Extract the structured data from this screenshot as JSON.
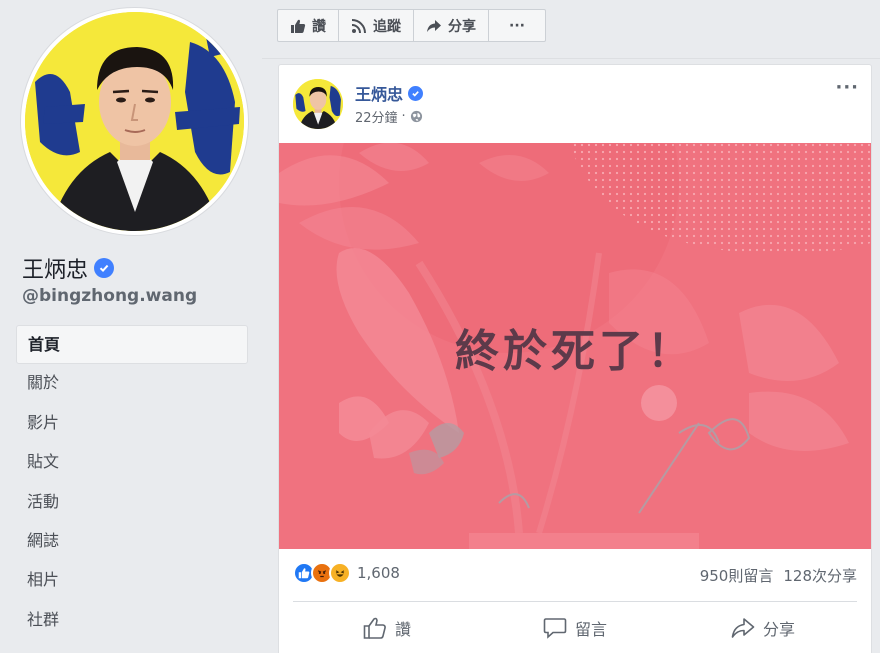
{
  "page": {
    "name": "王炳忠",
    "handle": "@bingzhong.wang"
  },
  "nav": {
    "items": [
      {
        "label": "首頁",
        "active": true
      },
      {
        "label": "關於"
      },
      {
        "label": "影片"
      },
      {
        "label": "貼文"
      },
      {
        "label": "活動"
      },
      {
        "label": "網誌"
      },
      {
        "label": "相片"
      },
      {
        "label": "社群"
      }
    ]
  },
  "action_bar": {
    "like_label": "讚",
    "follow_label": "追蹤",
    "share_label": "分享",
    "more_label": "···"
  },
  "post": {
    "author": "王炳忠",
    "time": "22分鐘",
    "more_label": "···",
    "image_text": "終於死了！",
    "image_bg": "#f0727f",
    "reaction_count": "1,608",
    "comments": "950則留言",
    "shares": "128次分享",
    "actions": {
      "like": "讚",
      "comment": "留言",
      "share": "分享"
    }
  },
  "colors": {
    "link_blue": "#365899",
    "verified_blue": "#4080ff",
    "like_blue": "#2078f4",
    "angry_orange": "#e9710f",
    "haha_yellow": "#f7b125"
  }
}
